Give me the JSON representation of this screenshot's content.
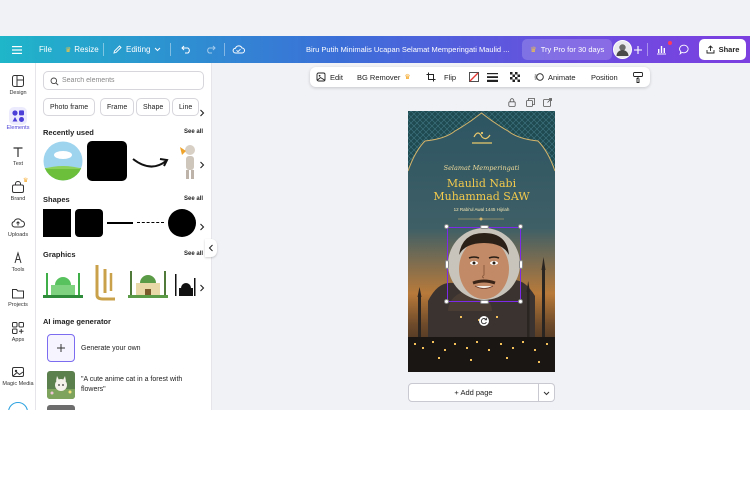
{
  "topbar": {
    "file_label": "File",
    "resize_label": "Resize",
    "editing_label": "Editing",
    "title": "Biru Putih Minimalis Ucapan Selamat Memperingati Maulid ...",
    "trypro_label": "Try Pro for 30 days",
    "share_label": "Share",
    "gradient_colors": [
      "#1fb6c9",
      "#3b6fd8",
      "#7c3fe0"
    ]
  },
  "rail": {
    "items": [
      {
        "label": "Design",
        "icon": "design-icon"
      },
      {
        "label": "Elements",
        "icon": "elements-icon",
        "active": true
      },
      {
        "label": "Text",
        "icon": "text-icon"
      },
      {
        "label": "Brand",
        "icon": "brand-icon"
      },
      {
        "label": "Uploads",
        "icon": "uploads-icon"
      },
      {
        "label": "Tools",
        "icon": "tools-icon"
      },
      {
        "label": "Projects",
        "icon": "projects-icon"
      },
      {
        "label": "Apps",
        "icon": "apps-icon"
      },
      {
        "label": "Magic Media",
        "icon": "magic-media-icon"
      }
    ]
  },
  "panel": {
    "search_placeholder": "Search elements",
    "chips": [
      "Photo frame",
      "Frame",
      "Shape",
      "Line"
    ],
    "recently_used": {
      "title": "Recently used",
      "see_all": "See all"
    },
    "shapes": {
      "title": "Shapes",
      "see_all": "See all"
    },
    "graphics": {
      "title": "Graphics",
      "see_all": "See all"
    },
    "ai": {
      "title": "AI image generator",
      "generate_label": "Generate your own",
      "example_prompt": "\"A cute anime cat in a forest with flowers\""
    }
  },
  "context_toolbar": {
    "edit_label": "Edit",
    "bg_remover_label": "BG Remover",
    "flip_label": "Flip",
    "animate_label": "Animate",
    "position_label": "Position"
  },
  "design": {
    "line1": "Selamat Memperingati",
    "line2": "Maulid Nabi",
    "line3": "Muhammad SAW",
    "line4": "12 Rabi'ul Awal 1445 Hijriah",
    "accent_color": "#f2c94c"
  },
  "canvas": {
    "add_page_label": "+ Add page"
  }
}
